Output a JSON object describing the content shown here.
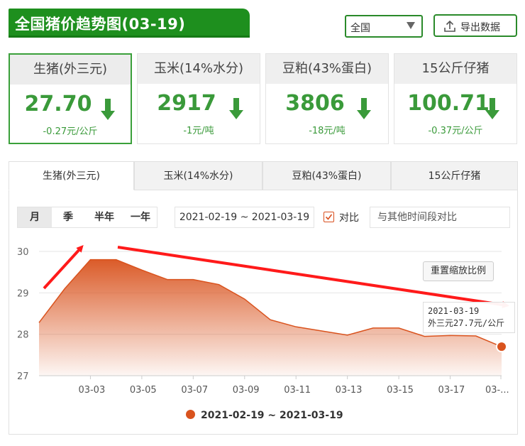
{
  "header": {
    "title": "全国猪价趋势图(03-19)",
    "region": "全国",
    "export_label": "导出数据"
  },
  "cards": [
    {
      "name": "生猪(外三元)",
      "value": "27.70",
      "change": "-0.27元/公斤",
      "trend": "down"
    },
    {
      "name": "玉米(14%水分)",
      "value": "2917",
      "change": "-1元/吨",
      "trend": "down"
    },
    {
      "name": "豆粕(43%蛋白)",
      "value": "3806",
      "change": "-18元/吨",
      "trend": "down"
    },
    {
      "name": "15公斤仔猪",
      "value": "100.71",
      "change": "-0.37元/公斤",
      "trend": "down"
    }
  ],
  "tabs": [
    "生猪(外三元)",
    "玉米(14%水分)",
    "豆粕(43%蛋白)",
    "15公斤仔猪"
  ],
  "periods": [
    "月",
    "季",
    "半年",
    "一年"
  ],
  "date_range": "2021-02-19 ~ 2021-03-19",
  "compare_label": "对比",
  "compare_placeholder": "与其他时间段对比",
  "reset_label": "重置缩放比例",
  "tooltip": {
    "date": "2021-03-19",
    "text": "外三元27.7元/公斤"
  },
  "colors": {
    "accent_green": "#1e8f1e",
    "down_green": "#3a9a3a",
    "series": "#d9531e",
    "annotation_red": "#ff1a1a"
  },
  "chart_data": {
    "type": "area",
    "x": [
      "2021-03-01",
      "2021-03-02",
      "2021-03-03",
      "2021-03-04",
      "2021-03-05",
      "2021-03-06",
      "2021-03-07",
      "2021-03-08",
      "2021-03-09",
      "2021-03-10",
      "2021-03-11",
      "2021-03-12",
      "2021-03-13",
      "2021-03-14",
      "2021-03-15",
      "2021-03-16",
      "2021-03-17",
      "2021-03-18",
      "2021-03-19"
    ],
    "xtick_labels": [
      "03-03",
      "03-05",
      "03-07",
      "03-09",
      "03-11",
      "03-13",
      "03-15",
      "03-17",
      "03-..."
    ],
    "series": [
      {
        "name": "2021-02-19 ~ 2021-03-19",
        "values": [
          28.28,
          29.1,
          29.8,
          29.8,
          29.55,
          29.32,
          29.32,
          29.2,
          28.85,
          28.35,
          28.18,
          28.08,
          27.98,
          28.15,
          28.15,
          27.95,
          27.97,
          27.96,
          27.7
        ]
      }
    ],
    "yticks": [
      27,
      28,
      29,
      30
    ],
    "ylim": [
      27,
      30
    ],
    "grid": true,
    "legend_position": "bottom-center"
  }
}
